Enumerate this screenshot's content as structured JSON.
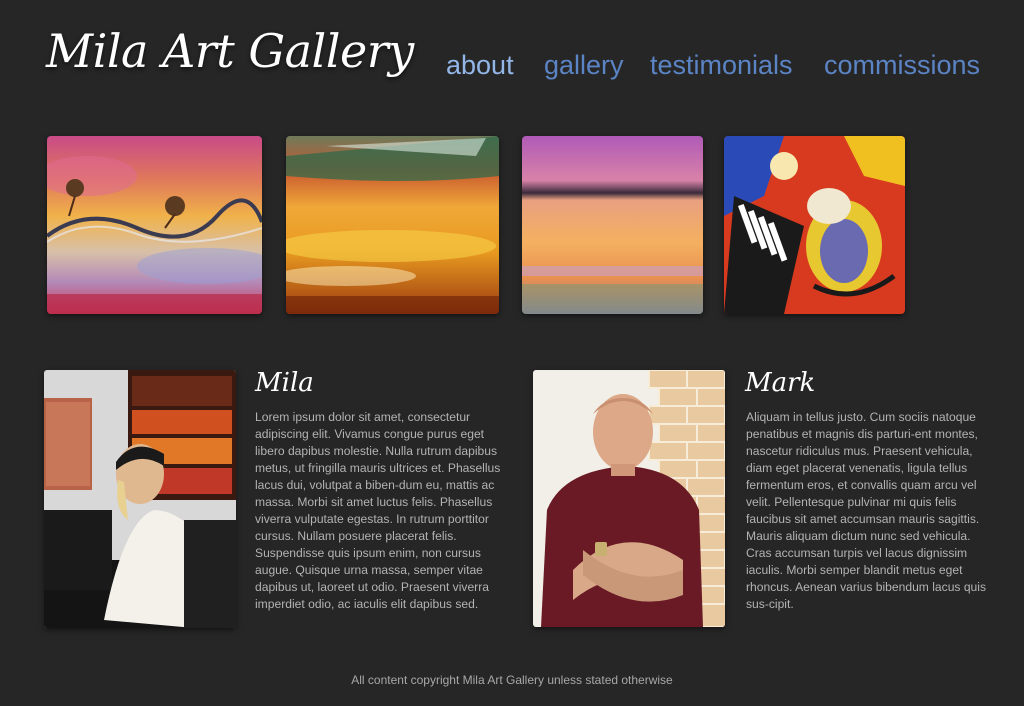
{
  "site": {
    "title": "Mila Art Gallery"
  },
  "nav": {
    "items": [
      {
        "label": "about",
        "active": true
      },
      {
        "label": "gallery",
        "active": false
      },
      {
        "label": "testimonials",
        "active": false
      },
      {
        "label": "commissions",
        "active": false
      }
    ]
  },
  "colors": {
    "background": "#262626",
    "nav_link": "#5b84c5",
    "nav_active": "#93b6e8",
    "heading": "#ffffff",
    "body_text": "#b3b3b3"
  },
  "profiles": {
    "mila": {
      "name": "Mila",
      "bio": "Lorem ipsum dolor sit amet, consectetur adipiscing elit. Vivamus congue purus eget libero dapibus molestie. Nulla rutrum dapibus metus, ut fringilla mauris ultrices et. Phasellus lacus dui, volutpat a biben-dum eu, mattis ac massa. Morbi sit amet luctus felis. Phasellus viverra vulputate egestas. In rutrum porttitor cursus. Nullam posuere placerat felis. Suspendisse quis ipsum enim, non cursus augue. Quisque urna massa, semper vitae dapibus ut, laoreet ut odio. Praesent viverra imperdiet odio, ac iaculis elit dapibus sed."
    },
    "mark": {
      "name": "Mark",
      "bio": "Aliquam in tellus justo. Cum sociis natoque penatibus et magnis dis parturi-ent montes, nascetur ridiculus mus. Praesent vehicula, diam eget placerat venenatis, ligula tellus fermentum eros, et convallis quam arcu vel velit. Pellentesque pulvinar mi quis felis faucibus sit amet accumsan mauris sagittis. Mauris aliquam dictum nunc sed vehicula. Cras accumsan turpis vel lacus dignissim iaculis. Morbi semper blandit metus eget rhoncus. Aenean varius bibendum lacus quis sus-cipit."
    }
  },
  "footer": {
    "text": "All content copyright Mila Art Gallery unless stated otherwise"
  }
}
